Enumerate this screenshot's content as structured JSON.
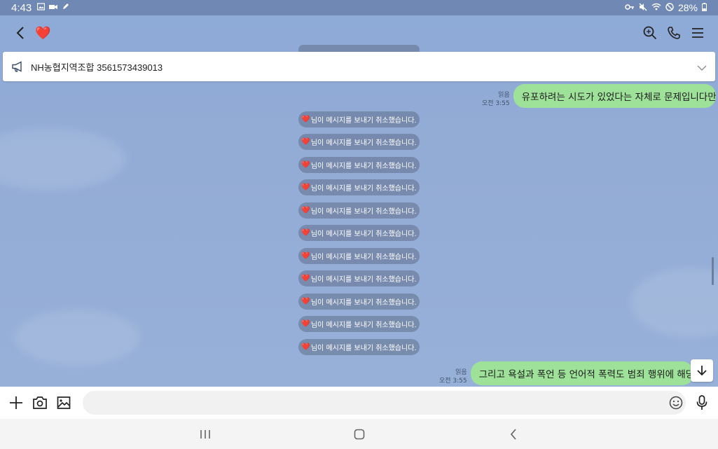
{
  "status_bar": {
    "time": "4:43",
    "battery": "28%"
  },
  "header": {
    "title": "❤️"
  },
  "notice": {
    "text": "NH농협지역조합 3561573439013"
  },
  "messages": {
    "sent_1": {
      "text": "유포하려는 시도가 있었다는 자체로 문제입니다만",
      "read": "읽음",
      "time": "오전 3:55"
    },
    "system_heart": "❤️",
    "system_text": "님이 메시지를 보내기 취소했습니다.",
    "sent_2": {
      "text": "그리고 욕설과 폭언 등 언어적 폭력도 범죄 행위에 해당합니다",
      "read": "읽음",
      "time": "오전 3:55"
    }
  },
  "input": {
    "placeholder": ""
  },
  "colors": {
    "sent_bubble": "#9ee29a",
    "chat_background": "#8fa9d2",
    "heart": "#e0202a"
  },
  "icons": {
    "back": "back-arrow-icon",
    "search": "search-icon",
    "call": "phone-icon",
    "menu": "menu-icon",
    "notice": "megaphone-icon",
    "expand": "chevron-down-icon",
    "plus": "plus-icon",
    "camera": "camera-icon",
    "gallery": "image-icon",
    "emoji": "emoji-icon",
    "mic": "mic-icon",
    "scroll_down": "arrow-down-icon"
  }
}
